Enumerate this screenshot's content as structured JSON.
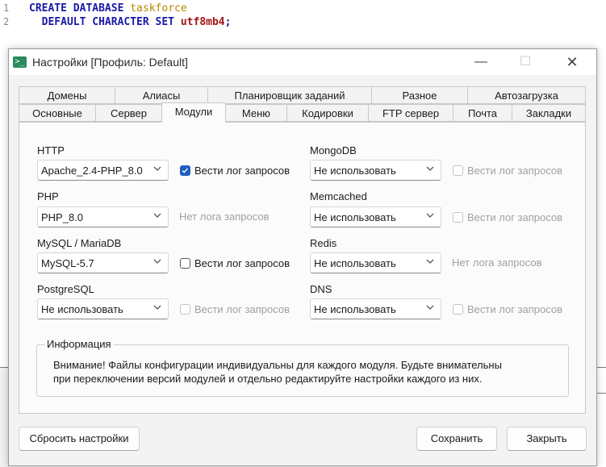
{
  "editor": {
    "lines": [
      {
        "num": "1",
        "kw1": "CREATE DATABASE",
        "ident": "taskforce",
        "kw2": "",
        "value": ""
      },
      {
        "num": "2",
        "kw1": "  DEFAULT CHARACTER SET",
        "ident": "",
        "kw2": "",
        "value": "utf8mb4",
        "tail": ";"
      }
    ]
  },
  "dialog": {
    "title": "Настройки [Профиль: Default]",
    "icon": ">_",
    "window_buttons": {
      "minimize": "—",
      "maximize": "☐",
      "close": "✕"
    }
  },
  "tabs": {
    "row1": [
      "Домены",
      "Алиасы",
      "Планировщик заданий",
      "Разное",
      "Автозагрузка"
    ],
    "row2": [
      "Основные",
      "Сервер",
      "Модули",
      "Меню",
      "Кодировки",
      "FTP сервер",
      "Почта",
      "Закладки"
    ],
    "active": "Модули"
  },
  "modules": {
    "left": [
      {
        "label": "HTTP",
        "value": "Apache_2.4-PHP_8.0",
        "log_text": "Вести лог запросов",
        "log_state": "checked"
      },
      {
        "label": "PHP",
        "value": "PHP_8.0",
        "log_text": "Нет лога запросов",
        "log_state": "none"
      },
      {
        "label": "MySQL / MariaDB",
        "value": "MySQL-5.7",
        "log_text": "Вести лог запросов",
        "log_state": "unchecked"
      },
      {
        "label": "PostgreSQL",
        "value": "Не использовать",
        "log_text": "Вести лог запросов",
        "log_state": "disabled"
      }
    ],
    "right": [
      {
        "label": "MongoDB",
        "value": "Не использовать",
        "log_text": "Вести лог запросов",
        "log_state": "disabled"
      },
      {
        "label": "Memcached",
        "value": "Не использовать",
        "log_text": "Вести лог запросов",
        "log_state": "disabled"
      },
      {
        "label": "Redis",
        "value": "Не использовать",
        "log_text": "Нет лога запросов",
        "log_state": "none"
      },
      {
        "label": "DNS",
        "value": "Не использовать",
        "log_text": "Вести лог запросов",
        "log_state": "disabled"
      }
    ]
  },
  "info": {
    "title": "Информация",
    "line1": "Внимание! Файлы конфигурации индивидуальны для каждого модуля. Будьте внимательны",
    "line2": "при переключении версий модулей и отдельно редактируйте настройки каждого из них."
  },
  "buttons": {
    "reset": "Сбросить настройки",
    "save": "Сохранить",
    "close": "Закрыть"
  },
  "colors": {
    "accent": "#1f5fbf",
    "keyword": "#1a1aa6",
    "identifier": "#b58900",
    "string": "#a31515"
  }
}
